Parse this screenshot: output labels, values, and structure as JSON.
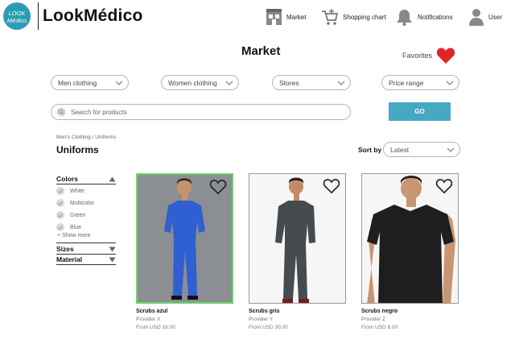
{
  "brand": {
    "logo_line1": "LOOK",
    "logo_line2": "Médico",
    "name": "LookMédico"
  },
  "nav": {
    "market": "Market",
    "cart": "Shopping chart",
    "notifications": "Notifications",
    "user": "User"
  },
  "page": {
    "title": "Market",
    "favorites": "Favorites"
  },
  "filters": {
    "men": "Men clothing",
    "women": "Women clothing",
    "stores": "Stores",
    "price": "Price range"
  },
  "search": {
    "placeholder": "Search for products",
    "go_label": "GO"
  },
  "breadcrumb": "Men's Clothing / Uniforms",
  "section_title": "Uniforms",
  "sort": {
    "label": "Sort by",
    "value": "Latest"
  },
  "sidebar": {
    "colors_label": "Colors",
    "colors": [
      "White",
      "Multicolor",
      "Green",
      "Blue"
    ],
    "show_more": "+ Show more",
    "sizes_label": "Sizes",
    "material_label": "Material"
  },
  "products": [
    {
      "name": "Scrubs azul",
      "provider": "Provider X",
      "price": "From USD 16.00",
      "color": "#2f5fd0",
      "selected": true
    },
    {
      "name": "Scrubs gris",
      "provider": "Provider Y",
      "price": "From USD 30.00",
      "color": "#464b50",
      "selected": false
    },
    {
      "name": "Scrubs negro",
      "provider": "Provider Z",
      "price": "From USD 8.00",
      "color": "#1e1e1e",
      "selected": false
    }
  ],
  "colors": {
    "accent": "#47a8c3",
    "logo": "#2a9db4",
    "favorite_heart": "#e02424",
    "selection": "#6fd36a"
  }
}
